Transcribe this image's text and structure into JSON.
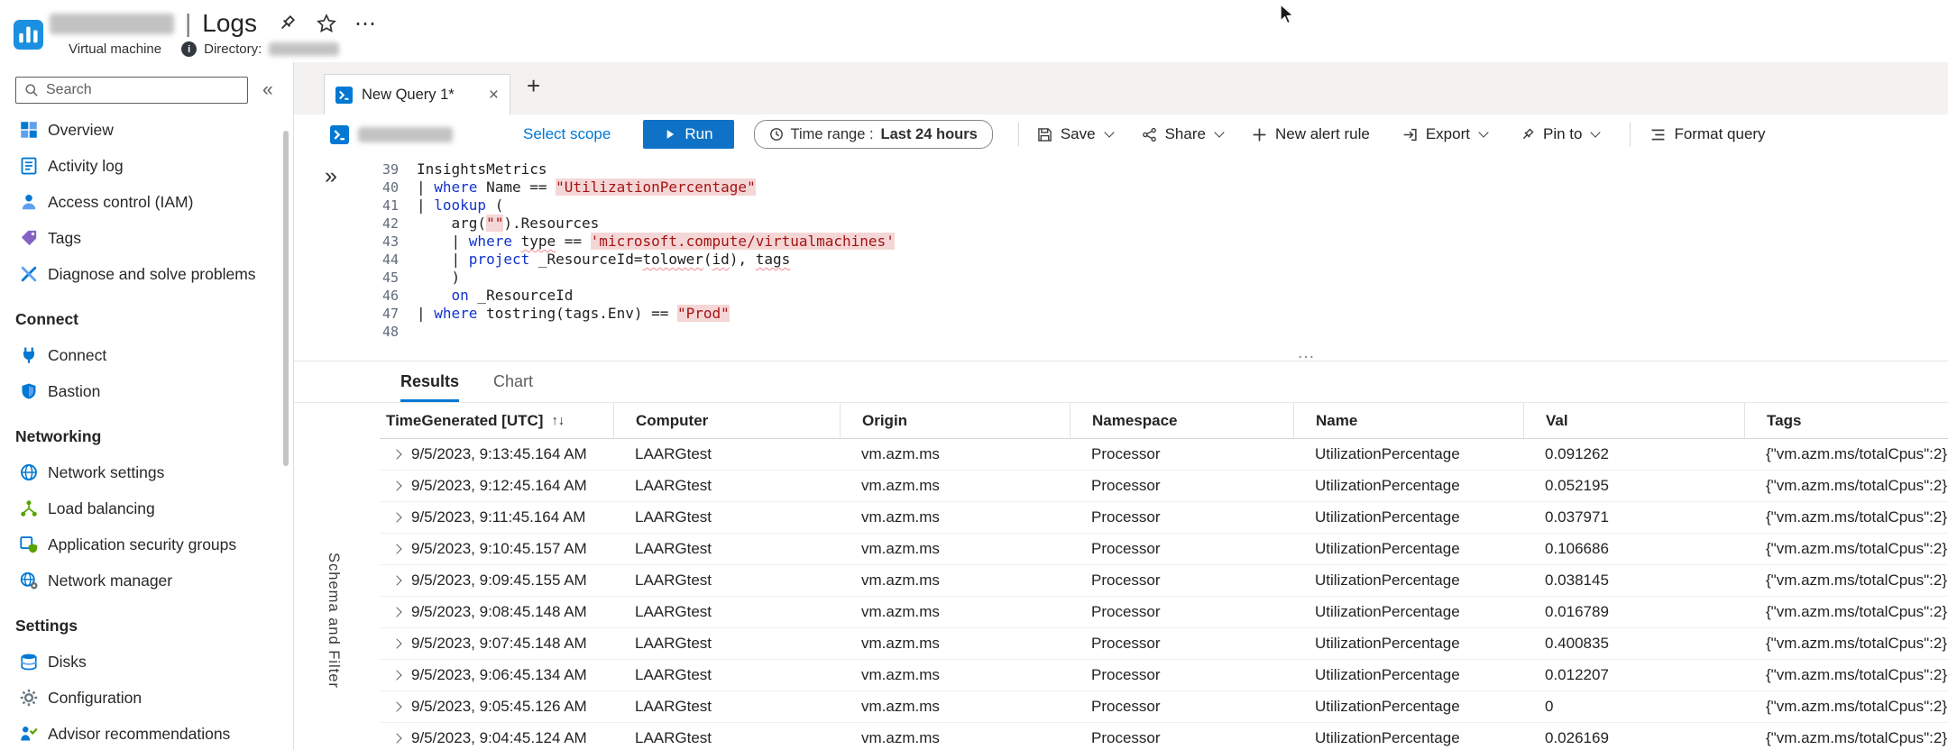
{
  "glyphs": {
    "close_tab": "×",
    "new_tab": "+",
    "collapse": "«",
    "expand": "»",
    "more": "⋯",
    "info": "i",
    "splitter": "…"
  },
  "header": {
    "title_separator": "|",
    "title": "Logs",
    "subtitle": "Virtual machine",
    "directory_label": "Directory:"
  },
  "sidebar": {
    "search_placeholder": "Search",
    "menu": [
      {
        "type": "item",
        "label": "Overview",
        "icon": "overview"
      },
      {
        "type": "item",
        "label": "Activity log",
        "icon": "activity-log"
      },
      {
        "type": "item",
        "label": "Access control (IAM)",
        "icon": "access-control"
      },
      {
        "type": "item",
        "label": "Tags",
        "icon": "tags"
      },
      {
        "type": "item",
        "label": "Diagnose and solve problems",
        "icon": "diagnose"
      },
      {
        "type": "header",
        "label": "Connect"
      },
      {
        "type": "item",
        "label": "Connect",
        "icon": "connect"
      },
      {
        "type": "item",
        "label": "Bastion",
        "icon": "bastion"
      },
      {
        "type": "header",
        "label": "Networking"
      },
      {
        "type": "item",
        "label": "Network settings",
        "icon": "network-settings"
      },
      {
        "type": "item",
        "label": "Load balancing",
        "icon": "load-balancing"
      },
      {
        "type": "item",
        "label": "Application security groups",
        "icon": "app-security-groups"
      },
      {
        "type": "item",
        "label": "Network manager",
        "icon": "network-manager"
      },
      {
        "type": "header",
        "label": "Settings"
      },
      {
        "type": "item",
        "label": "Disks",
        "icon": "disks"
      },
      {
        "type": "item",
        "label": "Configuration",
        "icon": "configuration"
      },
      {
        "type": "item",
        "label": "Advisor recommendations",
        "icon": "advisor"
      }
    ]
  },
  "tabs": {
    "active_label": "New Query 1*"
  },
  "toolbar": {
    "select_scope": "Select scope",
    "run": "Run",
    "time_range_label": "Time range :",
    "time_range_value": "Last 24 hours",
    "save": "Save",
    "share": "Share",
    "new_alert_rule": "New alert rule",
    "export": "Export",
    "pin_to": "Pin to",
    "format_query": "Format query"
  },
  "editor": {
    "lines": [
      {
        "n": 39,
        "segs": [
          {
            "c": "d",
            "t": "InsightsMetrics"
          }
        ]
      },
      {
        "n": 40,
        "segs": [
          {
            "c": "d",
            "t": "| "
          },
          {
            "c": "k",
            "t": "where"
          },
          {
            "c": "d",
            "t": " Name == "
          },
          {
            "c": "s",
            "t": "\"UtilizationPercentage\""
          }
        ]
      },
      {
        "n": 41,
        "segs": [
          {
            "c": "d",
            "t": "| "
          },
          {
            "c": "k",
            "t": "lookup"
          },
          {
            "c": "d",
            "t": " ("
          }
        ]
      },
      {
        "n": 42,
        "segs": [
          {
            "c": "d",
            "t": "    arg("
          },
          {
            "c": "s",
            "t": "\"\""
          },
          {
            "c": "d",
            "t": ").Resources"
          }
        ]
      },
      {
        "n": 43,
        "segs": [
          {
            "c": "d",
            "t": "    | "
          },
          {
            "c": "k",
            "t": "where"
          },
          {
            "c": "d",
            "t": " "
          },
          {
            "c": "w",
            "t": "type"
          },
          {
            "c": "d",
            "t": " == "
          },
          {
            "c": "s",
            "t": "'microsoft.compute/virtualmachines'"
          }
        ]
      },
      {
        "n": 44,
        "segs": [
          {
            "c": "d",
            "t": "    | "
          },
          {
            "c": "k",
            "t": "project"
          },
          {
            "c": "d",
            "t": " _ResourceId="
          },
          {
            "c": "w",
            "t": "tolower"
          },
          {
            "c": "d",
            "t": "("
          },
          {
            "c": "w",
            "t": "id"
          },
          {
            "c": "d",
            "t": "), "
          },
          {
            "c": "w",
            "t": "tags"
          }
        ]
      },
      {
        "n": 45,
        "segs": [
          {
            "c": "d",
            "t": "    )"
          }
        ]
      },
      {
        "n": 46,
        "segs": [
          {
            "c": "d",
            "t": "    "
          },
          {
            "c": "k",
            "t": "on"
          },
          {
            "c": "d",
            "t": " _ResourceId"
          }
        ]
      },
      {
        "n": 47,
        "segs": [
          {
            "c": "d",
            "t": "| "
          },
          {
            "c": "k",
            "t": "where"
          },
          {
            "c": "d",
            "t": " tostring(tags.Env) == "
          },
          {
            "c": "s",
            "t": "\"Prod\""
          }
        ]
      },
      {
        "n": 48,
        "segs": []
      }
    ]
  },
  "results": {
    "tabs": [
      "Results",
      "Chart"
    ],
    "sort_glyph": "↑↓",
    "columns": [
      "TimeGenerated [UTC]",
      "Computer",
      "Origin",
      "Namespace",
      "Name",
      "Val",
      "Tags"
    ],
    "rows": [
      {
        "time": "9/5/2023, 9:13:45.164 AM",
        "computer": "LAARGtest",
        "origin": "vm.azm.ms",
        "namespace": "Processor",
        "name": "UtilizationPercentage",
        "val": "0.091262",
        "tags": "{\"vm.azm.ms/totalCpus\":2}"
      },
      {
        "time": "9/5/2023, 9:12:45.164 AM",
        "computer": "LAARGtest",
        "origin": "vm.azm.ms",
        "namespace": "Processor",
        "name": "UtilizationPercentage",
        "val": "0.052195",
        "tags": "{\"vm.azm.ms/totalCpus\":2}"
      },
      {
        "time": "9/5/2023, 9:11:45.164 AM",
        "computer": "LAARGtest",
        "origin": "vm.azm.ms",
        "namespace": "Processor",
        "name": "UtilizationPercentage",
        "val": "0.037971",
        "tags": "{\"vm.azm.ms/totalCpus\":2}"
      },
      {
        "time": "9/5/2023, 9:10:45.157 AM",
        "computer": "LAARGtest",
        "origin": "vm.azm.ms",
        "namespace": "Processor",
        "name": "UtilizationPercentage",
        "val": "0.106686",
        "tags": "{\"vm.azm.ms/totalCpus\":2}"
      },
      {
        "time": "9/5/2023, 9:09:45.155 AM",
        "computer": "LAARGtest",
        "origin": "vm.azm.ms",
        "namespace": "Processor",
        "name": "UtilizationPercentage",
        "val": "0.038145",
        "tags": "{\"vm.azm.ms/totalCpus\":2}"
      },
      {
        "time": "9/5/2023, 9:08:45.148 AM",
        "computer": "LAARGtest",
        "origin": "vm.azm.ms",
        "namespace": "Processor",
        "name": "UtilizationPercentage",
        "val": "0.016789",
        "tags": "{\"vm.azm.ms/totalCpus\":2}"
      },
      {
        "time": "9/5/2023, 9:07:45.148 AM",
        "computer": "LAARGtest",
        "origin": "vm.azm.ms",
        "namespace": "Processor",
        "name": "UtilizationPercentage",
        "val": "0.400835",
        "tags": "{\"vm.azm.ms/totalCpus\":2}"
      },
      {
        "time": "9/5/2023, 9:06:45.134 AM",
        "computer": "LAARGtest",
        "origin": "vm.azm.ms",
        "namespace": "Processor",
        "name": "UtilizationPercentage",
        "val": "0.012207",
        "tags": "{\"vm.azm.ms/totalCpus\":2}"
      },
      {
        "time": "9/5/2023, 9:05:45.126 AM",
        "computer": "LAARGtest",
        "origin": "vm.azm.ms",
        "namespace": "Processor",
        "name": "UtilizationPercentage",
        "val": "0",
        "tags": "{\"vm.azm.ms/totalCpus\":2}"
      },
      {
        "time": "9/5/2023, 9:04:45.124 AM",
        "computer": "LAARGtest",
        "origin": "vm.azm.ms",
        "namespace": "Processor",
        "name": "UtilizationPercentage",
        "val": "0.026169",
        "tags": "{\"vm.azm.ms/totalCpus\":2}"
      }
    ]
  },
  "strip": {
    "label": "Schema and Filter"
  }
}
